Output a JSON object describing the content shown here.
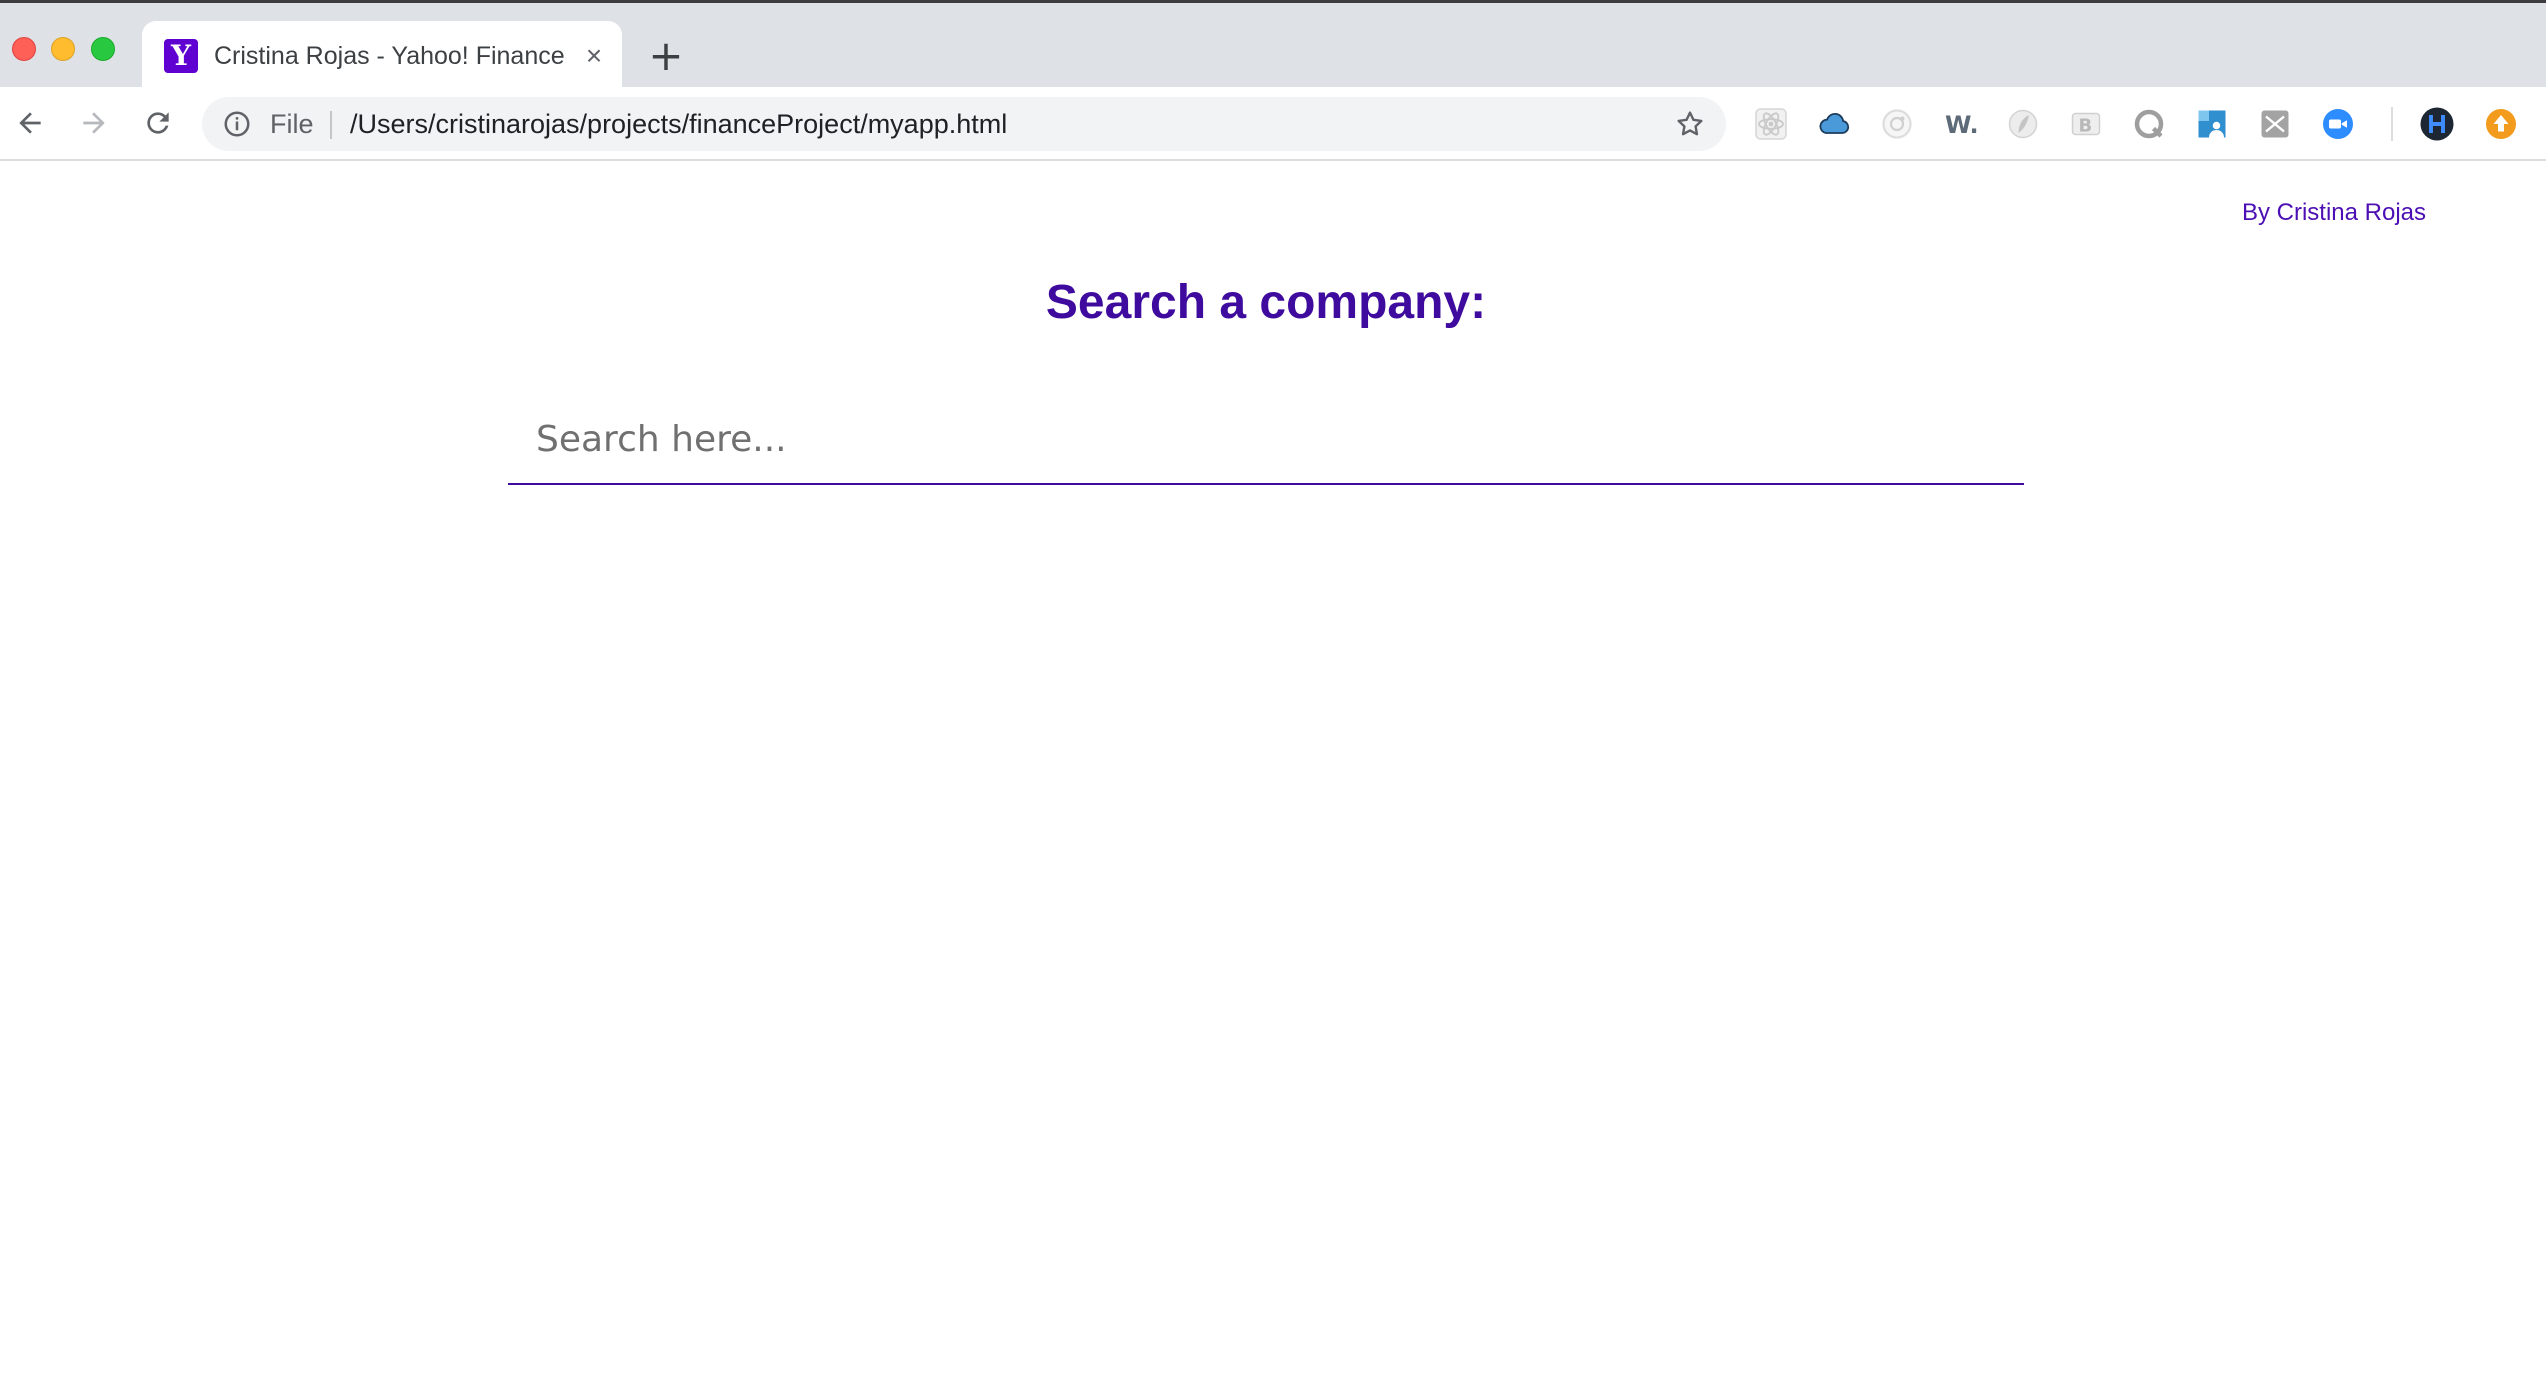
{
  "browser": {
    "tab": {
      "favicon_letter": "Y",
      "title": "Cristina Rojas - Yahoo! Finance",
      "close_glyph": "×"
    },
    "new_tab_glyph": "+",
    "omnibox": {
      "scheme_label": "File",
      "url": "/Users/cristinarojas/projects/financeProject/myapp.html"
    },
    "extensions": [
      "react-devtools-icon",
      "cloud-icon",
      "circle-extension-icon",
      "w-extension-icon",
      "leaf-extension-icon",
      "b-extension-icon",
      "q-extension-icon",
      "photo-extension-icon",
      "scissors-extension-icon",
      "zoom-video-icon",
      "h-profile-icon",
      "update-arrow-icon"
    ]
  },
  "page": {
    "byline": "By Cristina Rojas",
    "heading": "Search a company:",
    "search": {
      "placeholder": "Search here...",
      "value": ""
    }
  },
  "colors": {
    "accent": "#3f0b9e",
    "byline": "#4b0fb3",
    "favicon": "#5f01d1",
    "tabstrip": "#dee1e6"
  }
}
